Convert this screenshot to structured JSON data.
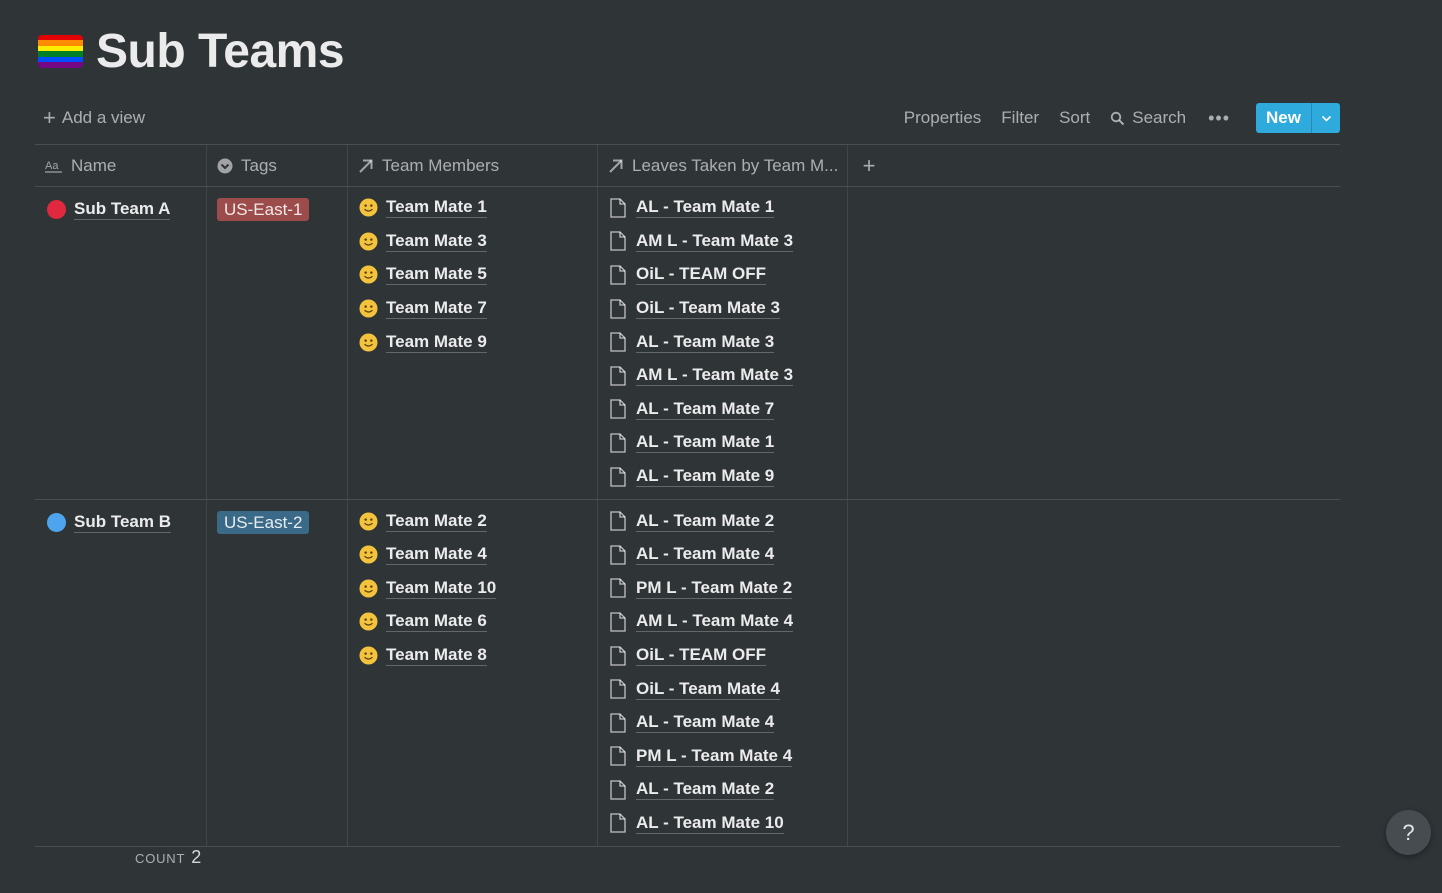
{
  "page": {
    "title": "Sub Teams",
    "icon": "rainbow-flag-icon",
    "flag_colors": [
      "#e40303",
      "#ff8c00",
      "#ffed00",
      "#008026",
      "#004dff",
      "#750787"
    ]
  },
  "toolbar": {
    "add_view_label": "Add a view",
    "properties_label": "Properties",
    "filter_label": "Filter",
    "sort_label": "Sort",
    "search_label": "Search",
    "more_label": "•••",
    "new_label": "New",
    "accent_color": "#2eaadc"
  },
  "columns": [
    {
      "label": "Name",
      "icon": "text-aa-icon"
    },
    {
      "label": "Tags",
      "icon": "select-icon"
    },
    {
      "label": "Team Members",
      "icon": "relation-arrow-icon"
    },
    {
      "label": "Leaves Taken by Team M...",
      "icon": "relation-arrow-icon"
    },
    {
      "label": "+",
      "icon": "add-column-icon"
    }
  ],
  "rows": [
    {
      "name": "Sub Team A",
      "dot_color": "#e0283e",
      "tag": "US-East-1",
      "tag_color": "#9c4c4a",
      "members": [
        "Team Mate 1",
        "Team Mate 3",
        "Team Mate 5",
        "Team Mate 7",
        "Team Mate 9"
      ],
      "leaves": [
        "AL - Team Mate 1",
        "AM L - Team Mate 3",
        "OiL - TEAM OFF",
        "OiL - Team Mate 3",
        "AL - Team Mate 3",
        "AM L - Team Mate 3",
        "AL - Team Mate 7",
        "AL - Team Mate 1",
        "AL - Team Mate 9"
      ]
    },
    {
      "name": "Sub Team B",
      "dot_color": "#4ea5ed",
      "tag": "US-East-2",
      "tag_color": "#3a6a87",
      "members": [
        "Team Mate 2",
        "Team Mate 4",
        "Team Mate 10",
        "Team Mate 6",
        "Team Mate 8"
      ],
      "leaves": [
        "AL - Team Mate 2",
        "AL - Team Mate 4",
        "PM L - Team Mate 2",
        "AM L - Team Mate 4",
        "OiL - TEAM OFF",
        "OiL - Team Mate 4",
        "AL - Team Mate 4",
        "PM L - Team Mate 4",
        "AL - Team Mate 2",
        "AL - Team Mate 10"
      ]
    }
  ],
  "footer": {
    "count_label": "COUNT",
    "count_value": "2"
  },
  "help": {
    "label": "?"
  }
}
